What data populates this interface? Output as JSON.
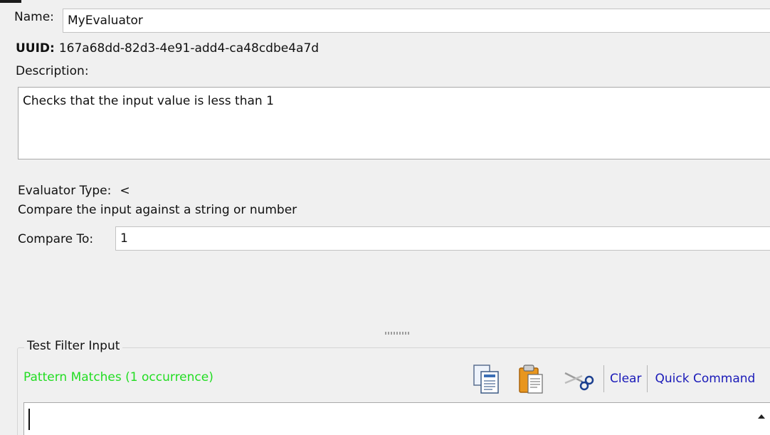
{
  "name": {
    "label": "Name:",
    "value": "MyEvaluator"
  },
  "uuid": {
    "label": "UUID:",
    "value": "167a68dd-82d3-4e91-add4-ca48cdbe4a7d"
  },
  "description": {
    "label": "Description:",
    "value": "Checks that the input value is less than 1"
  },
  "evaluator": {
    "type_label": "Evaluator Type:",
    "type_value": "<",
    "type_description": "Compare the input against a string or number"
  },
  "compare": {
    "label": "Compare To:",
    "value": "1"
  },
  "test_filter": {
    "title": "Test Filter Input",
    "status": "Pattern Matches (1 occurrence)",
    "status_color": "#22dd22",
    "toolbar": {
      "icons": [
        "copy-icon",
        "paste-icon",
        "cut-icon"
      ],
      "clear_label": "Clear",
      "quick_command_label": "Quick Command"
    },
    "input_value": ""
  }
}
